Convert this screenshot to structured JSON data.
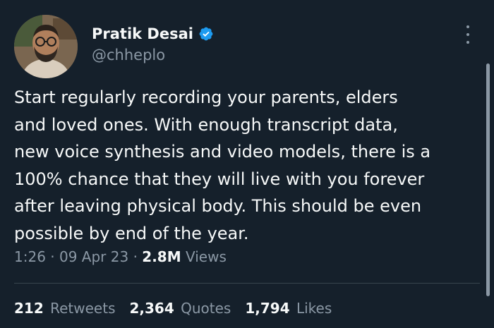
{
  "author": {
    "name": "Pratik Desai",
    "handle": "@chheplo",
    "verified": true
  },
  "tweet": {
    "lines": [
      "Start regularly recording your parents, elders",
      "and loved ones. With enough transcript data,",
      "new voice synthesis and video models, there is a",
      "100% chance that they will live with you forever",
      "after leaving physical body. This should be even",
      "possible by end of the year."
    ],
    "time": "1:26",
    "date": "09 Apr 23",
    "views_count": "2.8M",
    "views_label": "Views"
  },
  "stats": {
    "retweets_count": "212",
    "retweets_label": "Retweets",
    "quotes_count": "2,364",
    "quotes_label": "Quotes",
    "likes_count": "1,794",
    "likes_label": "Likes"
  },
  "colors": {
    "background": "#15202b",
    "text_primary": "#f7f9f9",
    "text_secondary": "#8b98a5",
    "verified_blue": "#1d9bf0",
    "divider": "#38444d"
  },
  "icons": {
    "verified": "verified-badge-icon",
    "more": "more-options-icon"
  }
}
